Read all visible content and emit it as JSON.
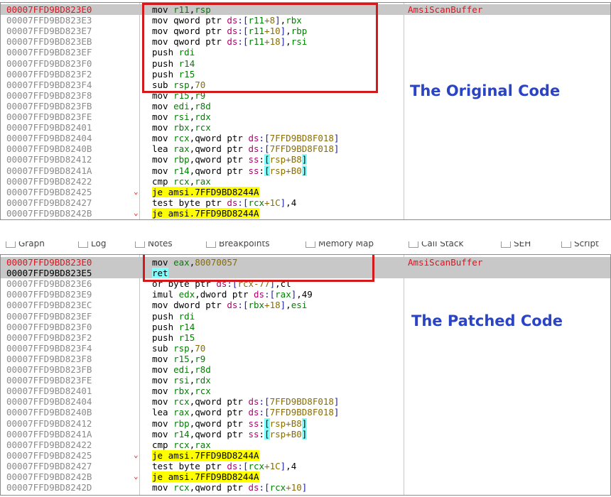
{
  "top": {
    "annotation": "The Original Code",
    "rows": [
      {
        "addr": "00007FFD9BD823E0",
        "ins": [
          [
            "mov ",
            "k"
          ],
          [
            "r11",
            "reg"
          ],
          [
            ",",
            "k"
          ],
          [
            "rsp",
            "reg"
          ]
        ],
        "label": "AmsiScanBuffer",
        "sel": true
      },
      {
        "addr": "00007FFD9BD823E3",
        "ins": [
          [
            "mov qword ptr ",
            "k"
          ],
          [
            "ds",
            "seg"
          ],
          [
            ":[",
            "br"
          ],
          [
            "r11",
            "reg"
          ],
          [
            "+8",
            "num"
          ],
          [
            "]",
            "br"
          ],
          [
            ",",
            "k"
          ],
          [
            "rbx",
            "reg"
          ]
        ]
      },
      {
        "addr": "00007FFD9BD823E7",
        "ins": [
          [
            "mov qword ptr ",
            "k"
          ],
          [
            "ds",
            "seg"
          ],
          [
            ":[",
            "br"
          ],
          [
            "r11",
            "reg"
          ],
          [
            "+10",
            "num"
          ],
          [
            "]",
            "br"
          ],
          [
            ",",
            "k"
          ],
          [
            "rbp",
            "reg"
          ]
        ]
      },
      {
        "addr": "00007FFD9BD823EB",
        "ins": [
          [
            "mov qword ptr ",
            "k"
          ],
          [
            "ds",
            "seg"
          ],
          [
            ":[",
            "br"
          ],
          [
            "r11",
            "reg"
          ],
          [
            "+18",
            "num"
          ],
          [
            "]",
            "br"
          ],
          [
            ",",
            "k"
          ],
          [
            "rsi",
            "reg"
          ]
        ]
      },
      {
        "addr": "00007FFD9BD823EF",
        "ins": [
          [
            "push ",
            "k"
          ],
          [
            "rdi",
            "reg"
          ]
        ]
      },
      {
        "addr": "00007FFD9BD823F0",
        "ins": [
          [
            "push ",
            "k"
          ],
          [
            "r14",
            "reg"
          ]
        ]
      },
      {
        "addr": "00007FFD9BD823F2",
        "ins": [
          [
            "push ",
            "k"
          ],
          [
            "r15",
            "reg"
          ]
        ]
      },
      {
        "addr": "00007FFD9BD823F4",
        "ins": [
          [
            "sub ",
            "k"
          ],
          [
            "rsp",
            "reg"
          ],
          [
            ",",
            "k"
          ],
          [
            "70",
            "num"
          ]
        ]
      },
      {
        "addr": "00007FFD9BD823F8",
        "ins": [
          [
            "mov ",
            "k"
          ],
          [
            "r15",
            "reg"
          ],
          [
            ",",
            "k"
          ],
          [
            "r9",
            "reg"
          ]
        ]
      },
      {
        "addr": "00007FFD9BD823FB",
        "ins": [
          [
            "mov ",
            "k"
          ],
          [
            "edi",
            "reg"
          ],
          [
            ",",
            "k"
          ],
          [
            "r8d",
            "reg"
          ]
        ]
      },
      {
        "addr": "00007FFD9BD823FE",
        "ins": [
          [
            "mov ",
            "k"
          ],
          [
            "rsi",
            "reg"
          ],
          [
            ",",
            "k"
          ],
          [
            "rdx",
            "reg"
          ]
        ]
      },
      {
        "addr": "00007FFD9BD82401",
        "ins": [
          [
            "mov ",
            "k"
          ],
          [
            "rbx",
            "reg"
          ],
          [
            ",",
            "k"
          ],
          [
            "rcx",
            "reg"
          ]
        ]
      },
      {
        "addr": "00007FFD9BD82404",
        "ins": [
          [
            "mov ",
            "k"
          ],
          [
            "rcx",
            "reg"
          ],
          [
            ",qword ptr ",
            "k"
          ],
          [
            "ds",
            "seg"
          ],
          [
            ":[",
            "br"
          ],
          [
            "7FFD9BD8F018",
            "num"
          ],
          [
            "]",
            "br"
          ]
        ]
      },
      {
        "addr": "00007FFD9BD8240B",
        "ins": [
          [
            "lea ",
            "k"
          ],
          [
            "rax",
            "reg"
          ],
          [
            ",qword ptr ",
            "k"
          ],
          [
            "ds",
            "seg"
          ],
          [
            ":[",
            "br"
          ],
          [
            "7FFD9BD8F018",
            "num"
          ],
          [
            "]",
            "br"
          ]
        ]
      },
      {
        "addr": "00007FFD9BD82412",
        "ins": [
          [
            "mov ",
            "k"
          ],
          [
            "rbp",
            "reg"
          ],
          [
            ",qword ptr ",
            "k"
          ],
          [
            "ss",
            "seg"
          ],
          [
            ":",
            "k"
          ],
          [
            "[",
            "cy"
          ],
          [
            "rsp+B8",
            "num"
          ],
          [
            "]",
            "cy"
          ]
        ]
      },
      {
        "addr": "00007FFD9BD8241A",
        "ins": [
          [
            "mov ",
            "k"
          ],
          [
            "r14",
            "reg"
          ],
          [
            ",qword ptr ",
            "k"
          ],
          [
            "ss",
            "seg"
          ],
          [
            ":",
            "k"
          ],
          [
            "[",
            "cy"
          ],
          [
            "rsp+B0",
            "num"
          ],
          [
            "]",
            "cy"
          ]
        ]
      },
      {
        "addr": "00007FFD9BD82422",
        "ins": [
          [
            "cmp ",
            "k"
          ],
          [
            "rcx",
            "reg"
          ],
          [
            ",",
            "k"
          ],
          [
            "rax",
            "reg"
          ]
        ]
      },
      {
        "addr": "00007FFD9BD82425",
        "ins": [
          [
            "je amsi.7FFD9BD8244A",
            "hl"
          ]
        ],
        "arrow": "⌄"
      },
      {
        "addr": "00007FFD9BD82427",
        "ins": [
          [
            "test byte ptr ",
            "k"
          ],
          [
            "ds",
            "seg"
          ],
          [
            ":[",
            "br"
          ],
          [
            "rcx",
            "reg"
          ],
          [
            "+1C",
            "num"
          ],
          [
            "]",
            "br"
          ],
          [
            ",4",
            "k"
          ]
        ]
      },
      {
        "addr": "00007FFD9BD8242B",
        "ins": [
          [
            "je amsi.7FFD9BD8244A",
            "hl"
          ]
        ],
        "arrow": "⌄"
      }
    ]
  },
  "toolbar": {
    "tabs": [
      "Graph",
      "Log",
      "Notes",
      "Breakpoints",
      "Memory Map",
      "Call Stack",
      "SEH",
      "Script"
    ]
  },
  "bottom": {
    "annotation": "The Patched Code",
    "rows": [
      {
        "addr": "00007FFD9BD823E0",
        "ins": [
          [
            "mov ",
            "k"
          ],
          [
            "eax",
            "reg"
          ],
          [
            ",",
            "k"
          ],
          [
            "80070057",
            "num"
          ]
        ],
        "label": "AmsiScanBuffer",
        "sel": true,
        "addrClass": "red"
      },
      {
        "addr": "00007FFD9BD823E5",
        "ins": [
          [
            "ret",
            "cy"
          ]
        ],
        "sel": true,
        "addrClass": "dark"
      },
      {
        "addr": "00007FFD9BD823E6",
        "ins": [
          [
            "or byte ptr ",
            "k"
          ],
          [
            "ds",
            "seg"
          ],
          [
            ":[",
            "br"
          ],
          [
            "rcx-77",
            "num"
          ],
          [
            "]",
            "br"
          ],
          [
            ",cl",
            "k"
          ]
        ]
      },
      {
        "addr": "00007FFD9BD823E9",
        "ins": [
          [
            "imul ",
            "k"
          ],
          [
            "edx",
            "reg"
          ],
          [
            ",dword ptr ",
            "k"
          ],
          [
            "ds",
            "seg"
          ],
          [
            ":[",
            "br"
          ],
          [
            "rax",
            "reg"
          ],
          [
            "]",
            "br"
          ],
          [
            ",49",
            "k"
          ]
        ]
      },
      {
        "addr": "00007FFD9BD823EC",
        "ins": [
          [
            "mov dword ptr ",
            "k"
          ],
          [
            "ds",
            "seg"
          ],
          [
            ":[",
            "br"
          ],
          [
            "rbx",
            "reg"
          ],
          [
            "+18",
            "num"
          ],
          [
            "]",
            "br"
          ],
          [
            ",",
            "k"
          ],
          [
            "esi",
            "reg"
          ]
        ]
      },
      {
        "addr": "00007FFD9BD823EF",
        "ins": [
          [
            "push ",
            "k"
          ],
          [
            "rdi",
            "reg"
          ]
        ]
      },
      {
        "addr": "00007FFD9BD823F0",
        "ins": [
          [
            "push ",
            "k"
          ],
          [
            "r14",
            "reg"
          ]
        ]
      },
      {
        "addr": "00007FFD9BD823F2",
        "ins": [
          [
            "push ",
            "k"
          ],
          [
            "r15",
            "reg"
          ]
        ]
      },
      {
        "addr": "00007FFD9BD823F4",
        "ins": [
          [
            "sub ",
            "k"
          ],
          [
            "rsp",
            "reg"
          ],
          [
            ",",
            "k"
          ],
          [
            "70",
            "num"
          ]
        ]
      },
      {
        "addr": "00007FFD9BD823F8",
        "ins": [
          [
            "mov ",
            "k"
          ],
          [
            "r15",
            "reg"
          ],
          [
            ",",
            "k"
          ],
          [
            "r9",
            "reg"
          ]
        ]
      },
      {
        "addr": "00007FFD9BD823FB",
        "ins": [
          [
            "mov ",
            "k"
          ],
          [
            "edi",
            "reg"
          ],
          [
            ",",
            "k"
          ],
          [
            "r8d",
            "reg"
          ]
        ]
      },
      {
        "addr": "00007FFD9BD823FE",
        "ins": [
          [
            "mov ",
            "k"
          ],
          [
            "rsi",
            "reg"
          ],
          [
            ",",
            "k"
          ],
          [
            "rdx",
            "reg"
          ]
        ]
      },
      {
        "addr": "00007FFD9BD82401",
        "ins": [
          [
            "mov ",
            "k"
          ],
          [
            "rbx",
            "reg"
          ],
          [
            ",",
            "k"
          ],
          [
            "rcx",
            "reg"
          ]
        ]
      },
      {
        "addr": "00007FFD9BD82404",
        "ins": [
          [
            "mov ",
            "k"
          ],
          [
            "rcx",
            "reg"
          ],
          [
            ",qword ptr ",
            "k"
          ],
          [
            "ds",
            "seg"
          ],
          [
            ":[",
            "br"
          ],
          [
            "7FFD9BD8F018",
            "num"
          ],
          [
            "]",
            "br"
          ]
        ]
      },
      {
        "addr": "00007FFD9BD8240B",
        "ins": [
          [
            "lea ",
            "k"
          ],
          [
            "rax",
            "reg"
          ],
          [
            ",qword ptr ",
            "k"
          ],
          [
            "ds",
            "seg"
          ],
          [
            ":[",
            "br"
          ],
          [
            "7FFD9BD8F018",
            "num"
          ],
          [
            "]",
            "br"
          ]
        ]
      },
      {
        "addr": "00007FFD9BD82412",
        "ins": [
          [
            "mov ",
            "k"
          ],
          [
            "rbp",
            "reg"
          ],
          [
            ",qword ptr ",
            "k"
          ],
          [
            "ss",
            "seg"
          ],
          [
            ":",
            "k"
          ],
          [
            "[",
            "cy"
          ],
          [
            "rsp+B8",
            "num"
          ],
          [
            "]",
            "cy"
          ]
        ]
      },
      {
        "addr": "00007FFD9BD8241A",
        "ins": [
          [
            "mov ",
            "k"
          ],
          [
            "r14",
            "reg"
          ],
          [
            ",qword ptr ",
            "k"
          ],
          [
            "ss",
            "seg"
          ],
          [
            ":",
            "k"
          ],
          [
            "[",
            "cy"
          ],
          [
            "rsp+B0",
            "num"
          ],
          [
            "]",
            "cy"
          ]
        ]
      },
      {
        "addr": "00007FFD9BD82422",
        "ins": [
          [
            "cmp ",
            "k"
          ],
          [
            "rcx",
            "reg"
          ],
          [
            ",",
            "k"
          ],
          [
            "rax",
            "reg"
          ]
        ]
      },
      {
        "addr": "00007FFD9BD82425",
        "ins": [
          [
            "je amsi.7FFD9BD8244A",
            "hl"
          ]
        ],
        "arrow": "⌄"
      },
      {
        "addr": "00007FFD9BD82427",
        "ins": [
          [
            "test byte ptr ",
            "k"
          ],
          [
            "ds",
            "seg"
          ],
          [
            ":[",
            "br"
          ],
          [
            "rcx",
            "reg"
          ],
          [
            "+1C",
            "num"
          ],
          [
            "]",
            "br"
          ],
          [
            ",4",
            "k"
          ]
        ]
      },
      {
        "addr": "00007FFD9BD8242B",
        "ins": [
          [
            "je amsi.7FFD9BD8244A",
            "hl"
          ]
        ],
        "arrow": "⌄"
      },
      {
        "addr": "00007FFD9BD8242D",
        "ins": [
          [
            "mov ",
            "k"
          ],
          [
            "rcx",
            "reg"
          ],
          [
            ",qword ptr ",
            "k"
          ],
          [
            "ds",
            "seg"
          ],
          [
            ":[",
            "br"
          ],
          [
            "rcx",
            "reg"
          ],
          [
            "+10",
            "num"
          ],
          [
            "]",
            "br"
          ]
        ]
      }
    ]
  }
}
